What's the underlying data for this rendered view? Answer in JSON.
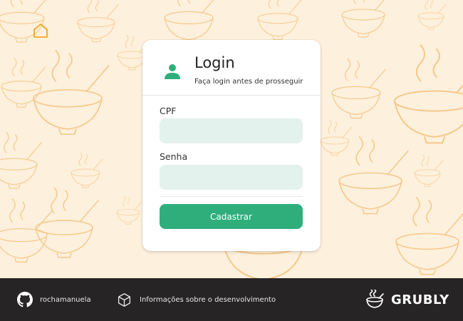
{
  "icons": {
    "home": "home-icon",
    "user": "user-icon",
    "github": "github-icon",
    "development": "cube-icon",
    "brand": "steaming-bowl-icon"
  },
  "colors": {
    "background": "#fdf0dc",
    "pattern": "#f4c98b",
    "accent_green": "#2fae7c",
    "input_bg": "#e3f2ec",
    "footer_bg": "#262424",
    "home_icon": "#f5a623"
  },
  "login": {
    "title": "Login",
    "subtitle": "Faça login antes de prosseguir",
    "cpf_label": "CPF",
    "cpf_value": "",
    "senha_label": "Senha",
    "senha_value": "",
    "submit_label": "Cadastrar"
  },
  "footer": {
    "github_user": "rochamanuela",
    "dev_info": "Informações sobre o desenvolvimento",
    "brand_name": "GRUBLY"
  }
}
